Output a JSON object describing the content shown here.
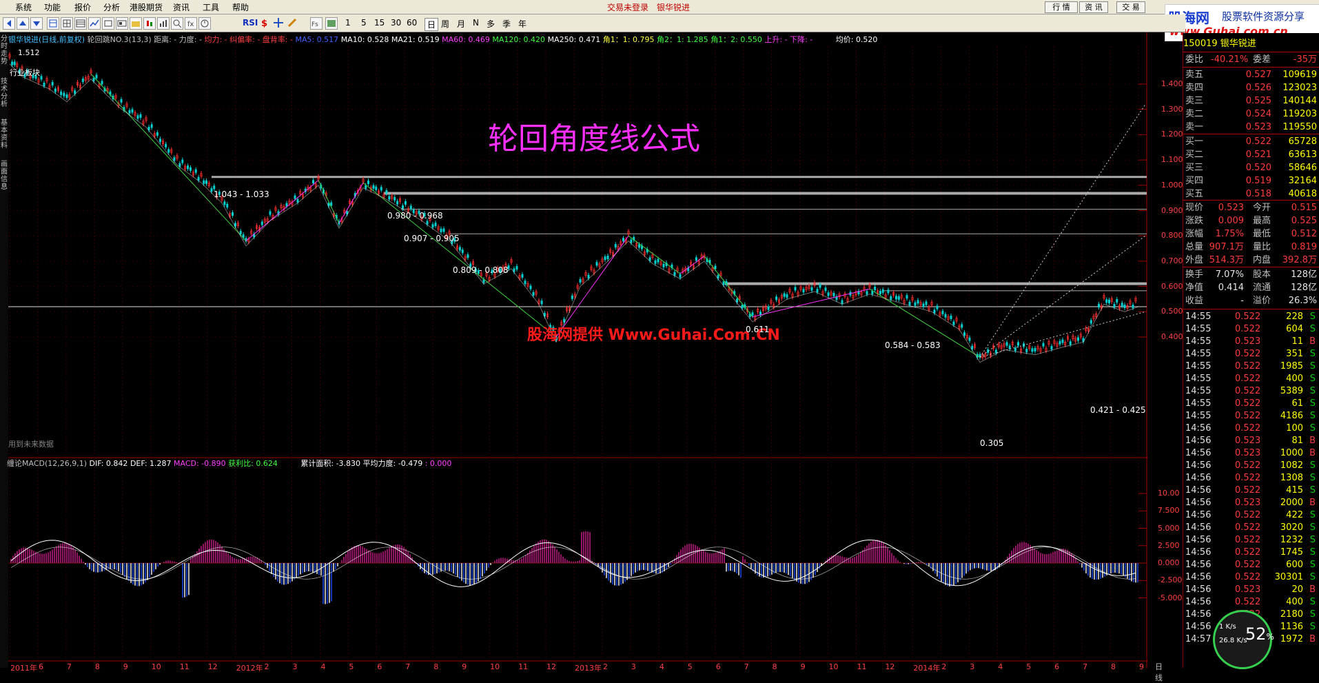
{
  "menu": {
    "items": [
      "系统",
      "功能",
      "报价",
      "分析",
      "港股期货",
      "资讯",
      "工具",
      "帮助"
    ],
    "status_center": "交易未登录",
    "stock_name_top": "银华锐进",
    "right_buttons": [
      "行 情",
      "资 讯",
      "交 易"
    ]
  },
  "toolbar": {
    "text_items": [
      "RSI",
      "1",
      "5",
      "15",
      "30",
      "60",
      "日",
      "周",
      "月",
      "N",
      "多",
      "季",
      "年"
    ]
  },
  "left_nav": [
    "分时走势",
    "技术分析",
    "基本资料",
    "画面信息"
  ],
  "chart": {
    "header_name": "银华锐进(日线,前复权)",
    "header_formula": "轮回跳NO.3(13,3)",
    "header_params": "距离: -  力度: -",
    "header_params2": "均力: -  纠偏率: -  盘背率: -",
    "ma5": "MA5: 0.517",
    "ma10": "MA10: 0.528",
    "ma21": "MA21: 0.519",
    "ma60": "MA60: 0.469",
    "ma120": "MA120: 0.420",
    "ma250": "MA250: 0.471",
    "angle1": "角1：1: 0.795",
    "angle2": "角2：1: 1.285",
    "angle3": "角1：2: 0.550",
    "updown": "上升: -  下降: -",
    "avg_price": "均价: 0.520",
    "max_price": "1.512",
    "sector_label": "行业板块",
    "future_data": "用到未来数据",
    "title_overlay": "轮回角度线公式",
    "watermark": "股海网提供 Www.Guhai.Com.CN",
    "right_axis_ticks": [
      "1.400",
      "1.300",
      "1.200",
      "1.100",
      "1.000",
      "0.900",
      "0.800",
      "0.700",
      "0.600",
      "0.500",
      "0.400"
    ],
    "price_labels": {
      "l1": "1.043 - 1.033",
      "l2": "0.980 - 0.968",
      "l3": "0.907 - 0.905",
      "l4": "0.809 - 0.808",
      "l5": "0.611",
      "l6": "0.584 - 0.583",
      "l7": "0.421 - 0.425",
      "l8": "0.305"
    },
    "x_labels": [
      "2011年",
      "6",
      "7",
      "8",
      "9",
      "10",
      "11",
      "12",
      "2012年",
      "2",
      "3",
      "4",
      "5",
      "6",
      "7",
      "8",
      "9",
      "10",
      "11",
      "12",
      "2013年",
      "2",
      "3",
      "4",
      "5",
      "6",
      "7",
      "8",
      "9",
      "10",
      "11",
      "12",
      "2014年",
      "2",
      "3",
      "4",
      "5",
      "6",
      "7",
      "8",
      "9"
    ],
    "period_label": "日线"
  },
  "macd": {
    "name": "缠论MACD(12,26,9,1)",
    "dif": "DIF: 0.842",
    "def": "DEF: 1.287",
    "macd": "MACD: -0.890",
    "profit": "获利比: 0.624",
    "area": "累计面积: -3.830",
    "avg_force": "平均力度: -0.479",
    "extra": ": 0.000",
    "right_axis_ticks": [
      "10.00",
      "7.500",
      "5.000",
      "2.500",
      "0.000",
      "-2.500",
      "-5.000"
    ]
  },
  "logo": {
    "brand": "股海网",
    "slogan": "股票软件资源分享",
    "url": "www.Guhai.com.cn"
  },
  "quote": {
    "code_line": "150019  银华锐进",
    "wb_label": "委比",
    "wb_value": "-40.21%",
    "wc_label": "委差",
    "wc_value": "-35万",
    "sells": [
      {
        "label": "卖五",
        "price": "0.527",
        "vol": "109619"
      },
      {
        "label": "卖四",
        "price": "0.526",
        "vol": "123023"
      },
      {
        "label": "卖三",
        "price": "0.525",
        "vol": "140144"
      },
      {
        "label": "卖二",
        "price": "0.524",
        "vol": "119203"
      },
      {
        "label": "卖一",
        "price": "0.523",
        "vol": "119550"
      }
    ],
    "buys": [
      {
        "label": "买一",
        "price": "0.522",
        "vol": "65728"
      },
      {
        "label": "买二",
        "price": "0.521",
        "vol": "63613"
      },
      {
        "label": "买三",
        "price": "0.520",
        "vol": "58646"
      },
      {
        "label": "买四",
        "price": "0.519",
        "vol": "32164"
      },
      {
        "label": "买五",
        "price": "0.518",
        "vol": "40618"
      }
    ],
    "stats": [
      {
        "l1": "现价",
        "v1": "0.523",
        "l2": "今开",
        "v2": "0.515"
      },
      {
        "l1": "涨跌",
        "v1": "0.009",
        "l2": "最高",
        "v2": "0.525"
      },
      {
        "l1": "涨幅",
        "v1": "1.75%",
        "l2": "最低",
        "v2": "0.512"
      },
      {
        "l1": "总量",
        "v1": "907.1万",
        "l2": "量比",
        "v2": "0.819"
      },
      {
        "l1": "外盘",
        "v1": "514.3万",
        "l2": "内盘",
        "v2": "392.8万"
      }
    ],
    "stats2": [
      {
        "l1": "换手",
        "v1": "7.07%",
        "l2": "股本",
        "v2": "128亿"
      },
      {
        "l1": "净值",
        "v1": "0.414",
        "l2": "流通",
        "v2": "128亿"
      },
      {
        "l1": "收益",
        "v1": "-",
        "l2": "溢价",
        "v2": "26.3%"
      }
    ],
    "ticks": [
      {
        "t": "14:55",
        "p": "0.522",
        "v": "228",
        "s": "S"
      },
      {
        "t": "14:55",
        "p": "0.522",
        "v": "604",
        "s": "S"
      },
      {
        "t": "14:55",
        "p": "0.523",
        "v": "11",
        "s": "B"
      },
      {
        "t": "14:55",
        "p": "0.522",
        "v": "351",
        "s": "S"
      },
      {
        "t": "14:55",
        "p": "0.522",
        "v": "1985",
        "s": "S"
      },
      {
        "t": "14:55",
        "p": "0.522",
        "v": "400",
        "s": "S"
      },
      {
        "t": "14:55",
        "p": "0.522",
        "v": "5389",
        "s": "S"
      },
      {
        "t": "14:55",
        "p": "0.522",
        "v": "61",
        "s": "S"
      },
      {
        "t": "14:55",
        "p": "0.522",
        "v": "4186",
        "s": "S"
      },
      {
        "t": "14:56",
        "p": "0.522",
        "v": "100",
        "s": "S"
      },
      {
        "t": "14:56",
        "p": "0.523",
        "v": "81",
        "s": "B"
      },
      {
        "t": "14:56",
        "p": "0.523",
        "v": "1000",
        "s": "B"
      },
      {
        "t": "14:56",
        "p": "0.522",
        "v": "1082",
        "s": "S"
      },
      {
        "t": "14:56",
        "p": "0.522",
        "v": "1308",
        "s": "S"
      },
      {
        "t": "14:56",
        "p": "0.522",
        "v": "415",
        "s": "S"
      },
      {
        "t": "14:56",
        "p": "0.523",
        "v": "2000",
        "s": "B"
      },
      {
        "t": "14:56",
        "p": "0.522",
        "v": "422",
        "s": "S"
      },
      {
        "t": "14:56",
        "p": "0.522",
        "v": "3020",
        "s": "S"
      },
      {
        "t": "14:56",
        "p": "0.522",
        "v": "1232",
        "s": "S"
      },
      {
        "t": "14:56",
        "p": "0.522",
        "v": "1745",
        "s": "S"
      },
      {
        "t": "14:56",
        "p": "0.522",
        "v": "600",
        "s": "S"
      },
      {
        "t": "14:56",
        "p": "0.522",
        "v": "30301",
        "s": "S"
      },
      {
        "t": "14:56",
        "p": "0.523",
        "v": "20",
        "s": "B"
      },
      {
        "t": "14:56",
        "p": "0.522",
        "v": "400",
        "s": "S"
      },
      {
        "t": "14:56",
        "p": "0.522",
        "v": "2180",
        "s": "S"
      },
      {
        "t": "14:56",
        "p": "0.522",
        "v": "1136",
        "s": "S"
      },
      {
        "t": "14:57",
        "p": "0.523",
        "v": "1972",
        "s": "B"
      }
    ]
  },
  "gauge": {
    "percent": "52",
    "unit": "%",
    "up": "1 K/s",
    "down": "26.8 K/s"
  },
  "colors": {
    "bg": "#000000",
    "up": "#ff3b3b",
    "down": "#00d0d0",
    "grid": "#800000",
    "magenta": "#ff00ff",
    "yellow": "#ffff00"
  }
}
